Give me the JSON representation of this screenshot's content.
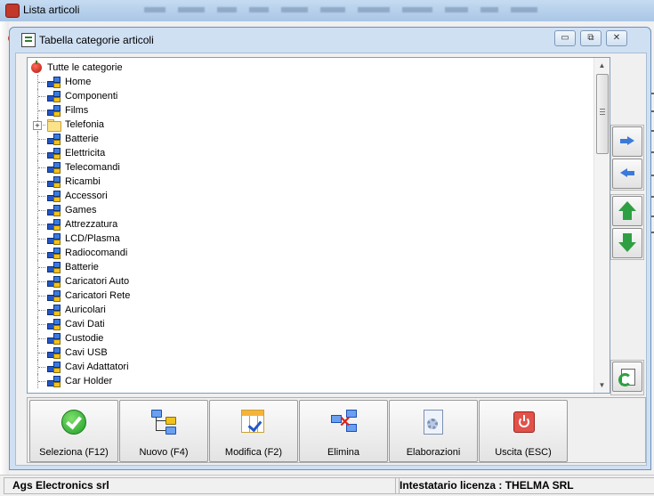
{
  "outer_window": {
    "title": "Lista articoli"
  },
  "dialog": {
    "title": "Tabella categorie articoli",
    "controls": {
      "minimize": "▭",
      "restore": "⧉",
      "close": "✕"
    }
  },
  "tree": {
    "root_label": "Tutte le categorie",
    "items": [
      {
        "label": "Home",
        "icon": "network-icon"
      },
      {
        "label": "Componenti",
        "icon": "network-icon"
      },
      {
        "label": "Films",
        "icon": "network-icon"
      },
      {
        "label": "Telefonia",
        "icon": "folder-icon",
        "expander": "+"
      },
      {
        "label": "Batterie",
        "icon": "network-icon"
      },
      {
        "label": "Elettricita",
        "icon": "network-icon"
      },
      {
        "label": "Telecomandi",
        "icon": "network-icon"
      },
      {
        "label": "Ricambi",
        "icon": "network-icon"
      },
      {
        "label": "Accessori",
        "icon": "network-icon"
      },
      {
        "label": "Games",
        "icon": "network-icon"
      },
      {
        "label": "Attrezzatura",
        "icon": "network-icon"
      },
      {
        "label": "LCD/Plasma",
        "icon": "network-icon"
      },
      {
        "label": "Radiocomandi",
        "icon": "network-icon"
      },
      {
        "label": "Batterie",
        "icon": "network-icon"
      },
      {
        "label": "Caricatori Auto",
        "icon": "network-icon"
      },
      {
        "label": "Caricatori Rete",
        "icon": "network-icon"
      },
      {
        "label": "Auricolari",
        "icon": "network-icon"
      },
      {
        "label": "Cavi Dati",
        "icon": "network-icon"
      },
      {
        "label": "Custodie",
        "icon": "network-icon"
      },
      {
        "label": "Cavi USB",
        "icon": "network-icon"
      },
      {
        "label": "Cavi Adattatori",
        "icon": "network-icon"
      },
      {
        "label": "Car Holder",
        "icon": "network-icon"
      }
    ]
  },
  "toolbar": {
    "select_label": "Seleziona (F12)",
    "new_label": "Nuovo (F4)",
    "edit_label": "Modifica (F2)",
    "delete_label": "Elimina",
    "process_label": "Elaborazioni",
    "exit_label": "Uscita (ESC)"
  },
  "statusbar": {
    "company": "Ags Electronics srl",
    "license": "Intestatario licenza : THELMA SRL"
  },
  "colors": {
    "accent_blue": "#3b7ad9",
    "accent_green": "#2ea043",
    "exit_red": "#e2524a"
  }
}
